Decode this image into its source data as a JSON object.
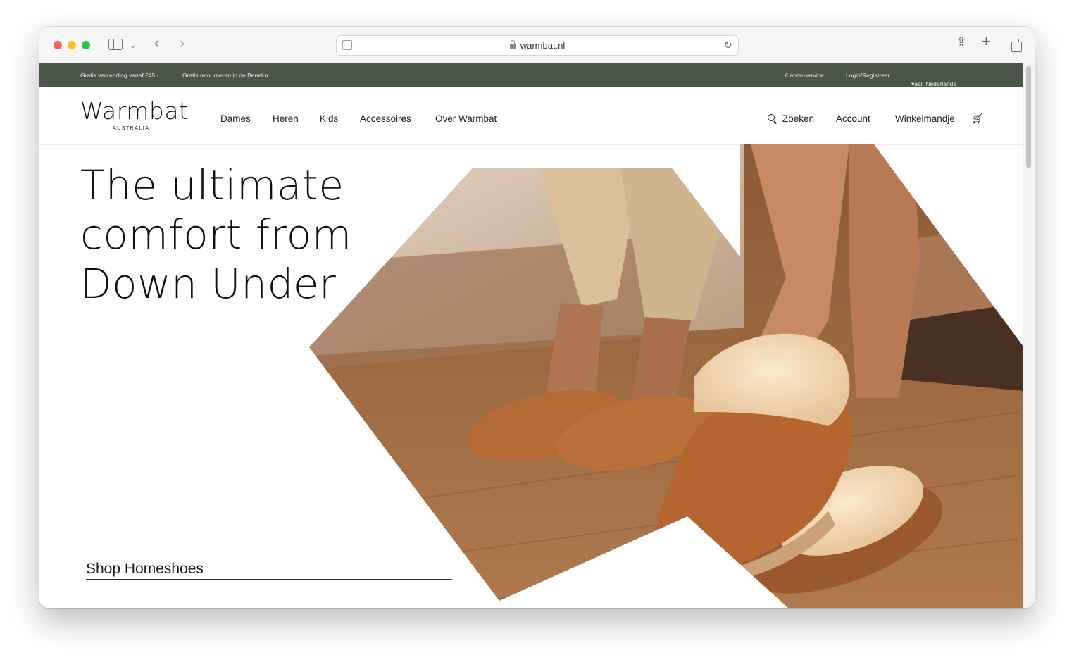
{
  "browser": {
    "url": "warmbat.nl"
  },
  "topbar": {
    "left": [
      "Gratis verzending vanaf €45,-",
      "Gratis retourneren in de Benelux"
    ],
    "right": {
      "service": "Klantenservice",
      "login": "Login/Registreer",
      "language": "Taal: Nederlands"
    }
  },
  "header": {
    "logo": {
      "name": "Warmbat",
      "tagline": "AUSTRALIA"
    },
    "nav": [
      "Dames",
      "Heren",
      "Kids",
      "Accessoires",
      "Over Warmbat"
    ],
    "search": "Zoeken",
    "account": "Account",
    "cart": "Winkelmandje"
  },
  "hero": {
    "title_lines": [
      "The ultimate",
      "comfort from",
      "Down Under"
    ],
    "cta": "Shop Homeshoes"
  },
  "colors": {
    "topbar_bg": "#4b5448",
    "text": "#111111"
  }
}
